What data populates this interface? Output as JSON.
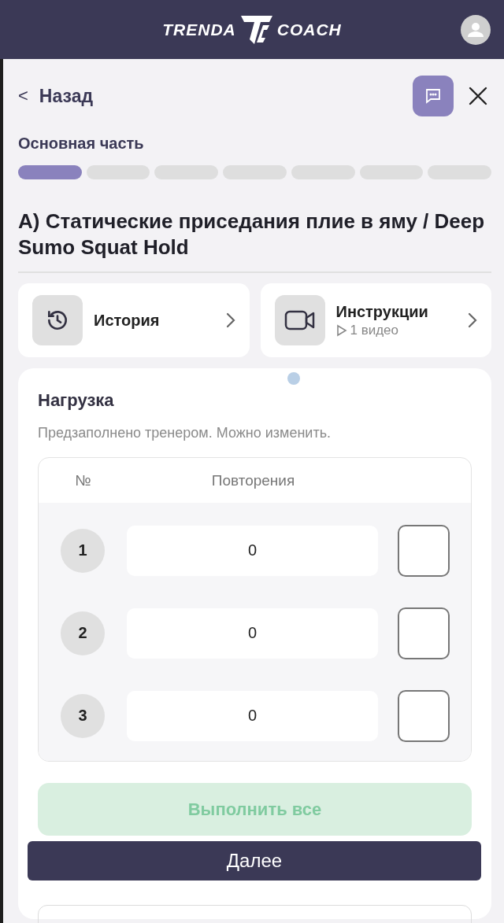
{
  "header": {
    "logo_left": "TRENDA",
    "logo_right": "COACH"
  },
  "nav": {
    "back": "Назад",
    "back_icon": "<"
  },
  "section": {
    "title": "Основная часть",
    "steps": [
      {
        "active": true
      },
      {
        "active": false
      },
      {
        "active": false
      },
      {
        "active": false
      },
      {
        "active": false
      },
      {
        "active": false
      },
      {
        "active": false
      }
    ]
  },
  "exercise": {
    "title": "А) Статические приседания плие в яму / Deep Sumo Squat Hold"
  },
  "links": [
    {
      "kind": "history",
      "label": "История"
    },
    {
      "kind": "video",
      "label": "Инструкции",
      "sub": "1 видео"
    }
  ],
  "load": {
    "title": "Нагрузка",
    "hint": "Предзаполнено тренером. Можно изменить.",
    "columns": [
      "№",
      "Повторения"
    ],
    "sets": [
      {
        "number": "1",
        "value": "0",
        "checked": false
      },
      {
        "number": "2",
        "value": "0",
        "checked": false
      },
      {
        "number": "3",
        "value": "0",
        "checked": false
      }
    ],
    "complete_all": "Выполнить все"
  },
  "next_button": "Далее"
}
